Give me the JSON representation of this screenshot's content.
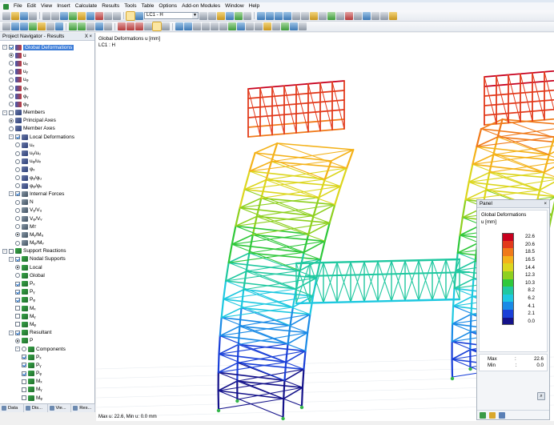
{
  "menu": [
    "File",
    "Edit",
    "View",
    "Insert",
    "Calculate",
    "Results",
    "Tools",
    "Table",
    "Options",
    "Add-on Modules",
    "Window",
    "Help"
  ],
  "load_case_combo": "LC1 - H",
  "navigator": {
    "title": "Project Navigator - Results",
    "controls": "Χ ×",
    "tree": [
      {
        "level": 0,
        "exp": "-",
        "chk": "on",
        "icon": "def",
        "label": "Global Deformations",
        "highlight": true
      },
      {
        "level": 1,
        "rad": "on",
        "icon": "def",
        "label": "u"
      },
      {
        "level": 1,
        "rad": "off",
        "icon": "def",
        "label": "uₓ"
      },
      {
        "level": 1,
        "rad": "off",
        "icon": "def",
        "label": "uᵧ"
      },
      {
        "level": 1,
        "rad": "off",
        "icon": "def",
        "label": "uᵩ"
      },
      {
        "level": 1,
        "rad": "off",
        "icon": "def",
        "label": "φₓ"
      },
      {
        "level": 1,
        "rad": "off",
        "icon": "def",
        "label": "φᵧ"
      },
      {
        "level": 1,
        "rad": "off",
        "icon": "def",
        "label": "φᵩ"
      },
      {
        "level": 0,
        "exp": "-",
        "chk": "off",
        "icon": "mem",
        "label": "Members"
      },
      {
        "level": 1,
        "rad": "on",
        "icon": "mem",
        "label": "Principal Axes"
      },
      {
        "level": 1,
        "rad": "off",
        "icon": "mem",
        "label": "Member Axes"
      },
      {
        "level": 1,
        "exp": "-",
        "chk": "on",
        "icon": "mem",
        "label": "Local Deformations"
      },
      {
        "level": 2,
        "rad": "off",
        "icon": "mem",
        "label": "uₓ"
      },
      {
        "level": 2,
        "rad": "off",
        "icon": "mem",
        "label": "uᵧ/uᵤ"
      },
      {
        "level": 2,
        "rad": "off",
        "icon": "mem",
        "label": "uᵩ/uᵥ"
      },
      {
        "level": 2,
        "rad": "off",
        "icon": "mem",
        "label": "φₓ"
      },
      {
        "level": 2,
        "rad": "off",
        "icon": "mem",
        "label": "φᵧ/φᵤ"
      },
      {
        "level": 2,
        "rad": "off",
        "icon": "mem",
        "label": "φᵩ/φᵥ"
      },
      {
        "level": 1,
        "exp": "-",
        "chk": "on",
        "icon": "frc",
        "label": "Internal Forces"
      },
      {
        "level": 2,
        "rad": "off",
        "icon": "frc",
        "label": "N"
      },
      {
        "level": 2,
        "rad": "off",
        "icon": "frc",
        "label": "Vᵧ/Vᵤ"
      },
      {
        "level": 2,
        "rad": "off",
        "icon": "frc",
        "label": "Vᵩ/Vᵥ"
      },
      {
        "level": 2,
        "rad": "off",
        "icon": "frc",
        "label": "Mᴛ"
      },
      {
        "level": 2,
        "rad": "on",
        "icon": "frc",
        "label": "Mᵧ/Mᵤ"
      },
      {
        "level": 2,
        "rad": "off",
        "icon": "frc",
        "label": "Mᵩ/Mᵥ"
      },
      {
        "level": 0,
        "exp": "-",
        "chk": "off",
        "icon": "sup",
        "label": "Support Reactions"
      },
      {
        "level": 1,
        "exp": "-",
        "chk": "on",
        "icon": "sup",
        "label": "Nodal Supports"
      },
      {
        "level": 2,
        "rad": "on",
        "icon": "sup",
        "label": "Local"
      },
      {
        "level": 2,
        "rad": "off",
        "icon": "sup",
        "label": "Global"
      },
      {
        "level": 2,
        "chk": "on",
        "icon": "sup",
        "label": "Pₓ"
      },
      {
        "level": 2,
        "chk": "on",
        "icon": "sup",
        "label": "Pᵧ"
      },
      {
        "level": 2,
        "chk": "on",
        "icon": "sup",
        "label": "Pᵩ"
      },
      {
        "level": 2,
        "chk": "off",
        "icon": "sup",
        "label": "Mₓ"
      },
      {
        "level": 2,
        "chk": "off",
        "icon": "sup",
        "label": "Mᵧ"
      },
      {
        "level": 2,
        "chk": "off",
        "icon": "sup",
        "label": "Mᵩ"
      },
      {
        "level": 1,
        "exp": "-",
        "chk": "on",
        "icon": "sup",
        "label": "Resultant"
      },
      {
        "level": 2,
        "rad": "on",
        "icon": "sup",
        "label": "P"
      },
      {
        "level": 2,
        "exp": "-",
        "rad": "off",
        "icon": "sup",
        "label": "Components"
      },
      {
        "level": 3,
        "chk": "on",
        "icon": "sup",
        "label": "Pₓ"
      },
      {
        "level": 3,
        "chk": "on",
        "icon": "sup",
        "label": "Pᵧ"
      },
      {
        "level": 3,
        "chk": "on",
        "icon": "sup",
        "label": "Pᵩ"
      },
      {
        "level": 3,
        "chk": "off",
        "icon": "sup",
        "label": "Mₓ"
      },
      {
        "level": 3,
        "chk": "off",
        "icon": "sup",
        "label": "Mᵧ"
      },
      {
        "level": 3,
        "chk": "off",
        "icon": "sup",
        "label": "Mᵩ"
      }
    ],
    "tabs": [
      "Data",
      "Dis...",
      "Vie...",
      "Res..."
    ]
  },
  "view": {
    "info_line1": "Global Deformations u [mm]",
    "info_line2": "LC1 : H",
    "status": "Max u: 22.6, Min u: 0.0 mm"
  },
  "panel": {
    "title": "Panel",
    "close": "×",
    "result_title": "Global Deformations",
    "result_unit": "u [mm]",
    "legend": [
      {
        "value": "22.6",
        "color": "#c8001e"
      },
      {
        "value": "20.6",
        "color": "#e23a1c"
      },
      {
        "value": "18.5",
        "color": "#f07a1a"
      },
      {
        "value": "16.5",
        "color": "#f4b21a"
      },
      {
        "value": "14.4",
        "color": "#dcd61e"
      },
      {
        "value": "12.3",
        "color": "#8ed020"
      },
      {
        "value": "10.3",
        "color": "#2fc83a"
      },
      {
        "value": "8.2",
        "color": "#20c8a0"
      },
      {
        "value": "6.2",
        "color": "#1ec8e0"
      },
      {
        "value": "4.1",
        "color": "#1a8ae6"
      },
      {
        "value": "2.1",
        "color": "#1a40d8"
      },
      {
        "value": "0.0",
        "color": "#14128a"
      }
    ],
    "max_label": "Max",
    "max_value": "22.6",
    "min_label": "Min",
    "min_value": "0.0",
    "colon": ":"
  }
}
